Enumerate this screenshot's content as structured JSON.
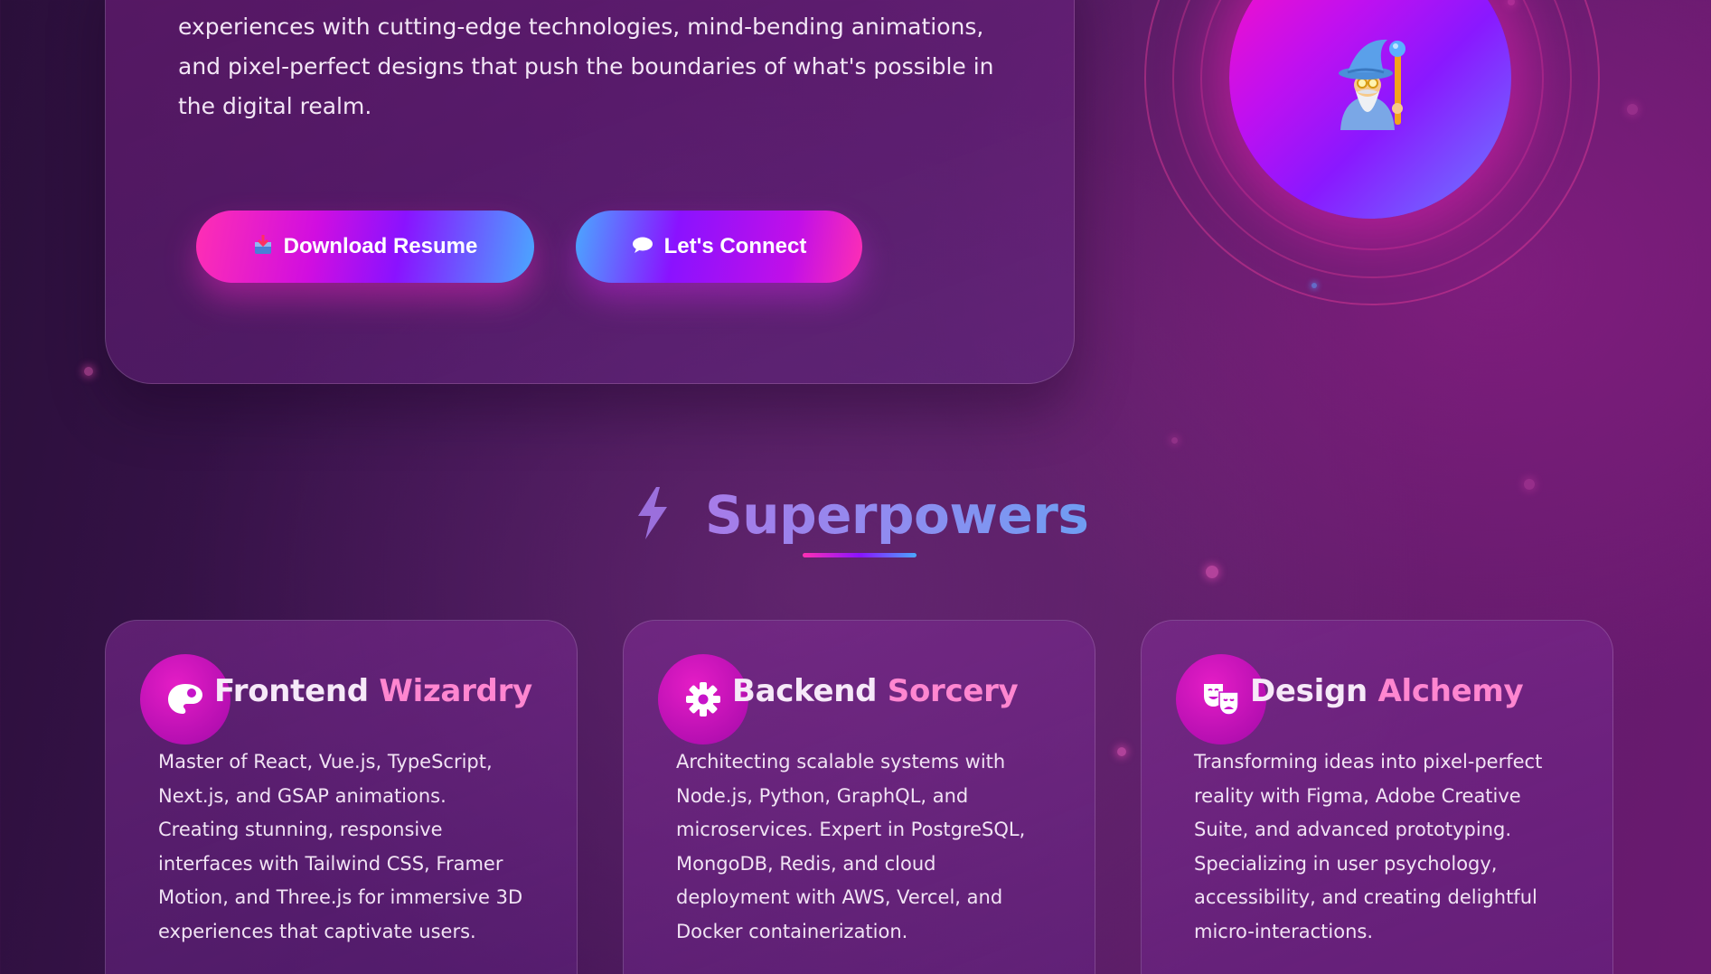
{
  "hero": {
    "description": "experiences with cutting-edge technologies, mind-bending animations, and pixel-perfect designs that push the boundaries of what's possible in the digital realm.",
    "download_button": {
      "icon": "inbox-tray-icon",
      "label": "Download Resume"
    },
    "connect_button": {
      "icon": "speech-bubble-icon",
      "label": "Let's Connect"
    },
    "avatar": {
      "icon": "wizard-icon"
    }
  },
  "superpowers": {
    "icon": "lightning-bolt-icon",
    "title": "Superpowers",
    "cards": [
      {
        "icon": "palette-icon",
        "title_first": "Frontend",
        "title_second": "Wizardry",
        "description": "Master of React, Vue.js, TypeScript, Next.js, and GSAP animations. Creating stunning, responsive interfaces with Tailwind CSS, Framer Motion, and Three.js for immersive 3D experiences that captivate users."
      },
      {
        "icon": "gear-icon",
        "title_first": "Backend",
        "title_second": "Sorcery",
        "description": "Architecting scalable systems with Node.js, Python, GraphQL, and microservices. Expert in PostgreSQL, MongoDB, Redis, and cloud deployment with AWS, Vercel, and Docker containerization."
      },
      {
        "icon": "theater-masks-icon",
        "title_first": "Design",
        "title_second": "Alchemy",
        "description": "Transforming ideas into pixel-perfect reality with Figma, Adobe Creative Suite, and advanced prototyping. Specializing in user psychology, accessibility, and creating delightful micro-interactions."
      }
    ]
  },
  "colors": {
    "accent_pink": "#ff2fb3",
    "accent_purple": "#8a12ff",
    "accent_blue": "#4aa8ff",
    "title_highlight": "#ff86d0"
  }
}
